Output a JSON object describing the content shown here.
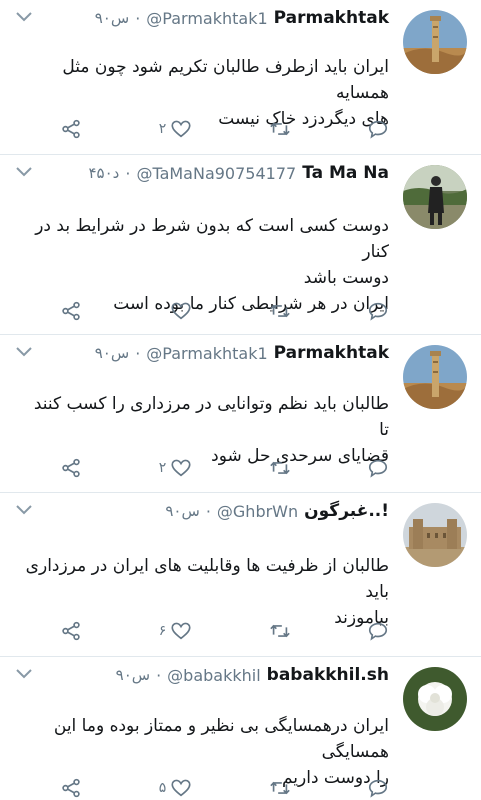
{
  "tweets": [
    {
      "name": "Parmakhtak",
      "handle": "@Parmakhtak1",
      "time": "۹۰س",
      "lines": [
        "ایران باید ازطرف طالبان تکریم شود چون مثل همسایه",
        "های دیگردزد خاک نیست"
      ],
      "like_count": "۲",
      "avatar": "minaret-photo"
    },
    {
      "name": "Ta Ma Na",
      "handle": "@TaMaNa90754177",
      "time": "۴۵۰د",
      "lines": [
        "دوست کسی است که بدون شرط  در شرایط بد در کنار",
        "دوست باشد",
        "ایران در هر شرایطی کنار ما بوده است"
      ],
      "like_count": "",
      "avatar": "person-in-field-photo"
    },
    {
      "name": "Parmakhtak",
      "handle": "@Parmakhtak1",
      "time": "۹۰س",
      "lines": [
        "طالبان باید نظم وتوانایی در مرزداری را کسب کنند تا",
        "قضایای سرحدی حل شود"
      ],
      "like_count": "۲",
      "avatar": "minaret-photo"
    },
    {
      "name": "غبرگون..!",
      "handle": "@GhbrWn",
      "time": "۹۰س",
      "lines": [
        "طالبان از ظرفیت ها وقابلیت های  ایران در مرزداری باید",
        "بیاموزند"
      ],
      "like_count": "۶",
      "avatar": "fortress-photo"
    },
    {
      "name": "babakkhil.sh",
      "handle": "@babakkhil",
      "time": "۹۰س",
      "lines": [
        "ایران درهمسایگی بی نظیر و ممتاز بوده وما این همسایگی",
        "را دوست داریم"
      ],
      "like_count": "۵",
      "avatar": "white-flower-photo"
    }
  ],
  "colors": {
    "text": "#14171a",
    "muted": "#657786",
    "icon": "#657786",
    "divider": "#e1e8ed"
  },
  "icons": [
    "chevron-down-icon",
    "share-icon",
    "like-icon",
    "retweet-icon",
    "reply-icon"
  ]
}
